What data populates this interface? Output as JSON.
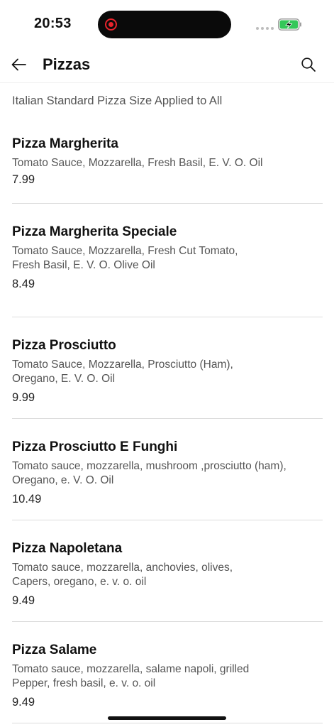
{
  "status_bar": {
    "time": "20:53"
  },
  "header": {
    "title": "Pizzas",
    "back_icon": "arrow-left-icon",
    "search_icon": "search-icon"
  },
  "subheader": "Italian Standard Pizza Size Applied to All",
  "items": [
    {
      "name": "Pizza Margherita",
      "description": "Tomato Sauce, Mozzarella, Fresh Basil, E. V. O. Oil",
      "price": "7.99"
    },
    {
      "name": "Pizza Margherita Speciale",
      "description": "Tomato Sauce, Mozzarella, Fresh Cut Tomato,\nFresh Basil, E. V. O. Olive Oil",
      "price": "8.49"
    },
    {
      "name": "Pizza Prosciutto",
      "description": "Tomato Sauce, Mozzarella, Prosciutto (Ham),\nOregano, E. V. O. Oil",
      "price": "9.99"
    },
    {
      "name": "Pizza Prosciutto E Funghi",
      "description": "Tomato sauce, mozzarella, mushroom ,prosciutto (ham),\nOregano, e. V. O. Oil",
      "price": "10.49"
    },
    {
      "name": "Pizza Napoletana",
      "description": "Tomato sauce, mozzarella, anchovies, olives,\nCapers, oregano, e. v. o. oil",
      "price": "9.49"
    },
    {
      "name": "Pizza Salame",
      "description": "Tomato sauce, mozzarella, salame napoli, grilled\nPepper, fresh basil, e. v. o. oil",
      "price": "9.49"
    }
  ],
  "colors": {
    "recording": "#e8242c",
    "battery_charging": "#34c759",
    "divider": "#dcdcdc"
  }
}
